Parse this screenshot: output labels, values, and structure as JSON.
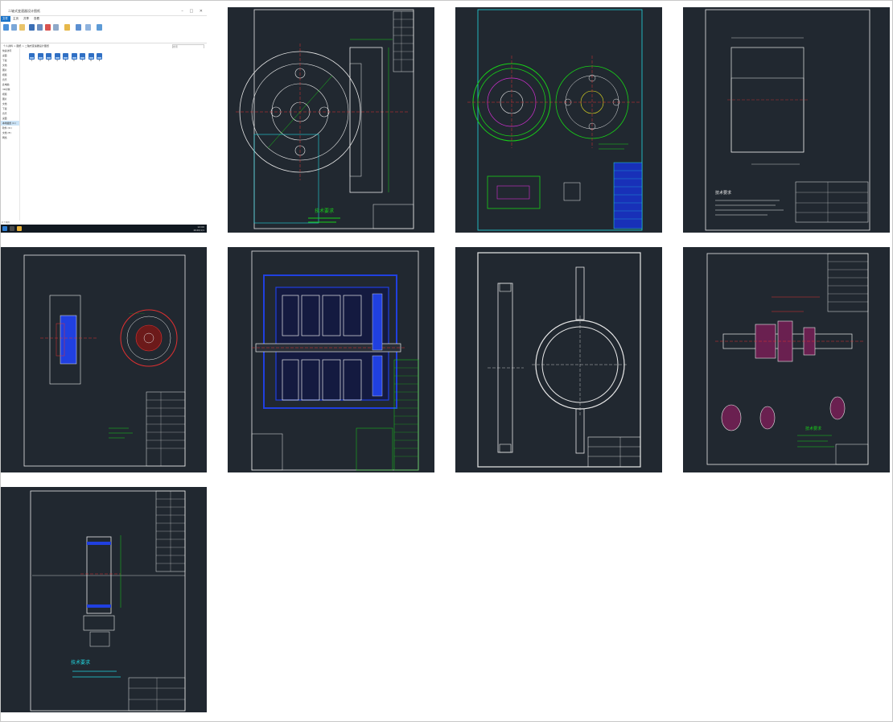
{
  "explorer": {
    "title": "二轴式变速器设计图纸",
    "tabs": [
      "文件",
      "主页",
      "共享",
      "查看"
    ],
    "address": "个人资料 > 图纸 > 二轴式变速器设计图纸",
    "search_placeholder": "搜索",
    "nav_items": [
      "快速访问",
      "桌面",
      "下载",
      "文档",
      "图片",
      "视频",
      "音乐",
      "此电脑",
      "3D对象",
      "视频",
      "图片",
      "文档",
      "下载",
      "音乐",
      "桌面",
      "本地磁盘 (C:)",
      "软件 (D:)",
      "文档 (E:)",
      "网络"
    ],
    "files": [
      "1",
      "2",
      "3",
      "4",
      "5",
      "6",
      "7",
      "8",
      "9"
    ],
    "status": "9 个项目",
    "clock_time": "12:00",
    "clock_date": "2020/1/1"
  },
  "drawings": [
    {
      "id": "flywheel",
      "notes": "技术要求"
    },
    {
      "id": "clutch-disc"
    },
    {
      "id": "shaft-sleeve",
      "notes": "技术要求"
    },
    {
      "id": "clutch-assembly"
    },
    {
      "id": "gearbox-assembly"
    },
    {
      "id": "ring-plate"
    },
    {
      "id": "gear-shaft",
      "notes": "技术要求"
    },
    {
      "id": "gear-blank",
      "notes": "技术要求"
    }
  ],
  "colors": {
    "cad_background": "#212830",
    "cad_white": "#e8e8e8",
    "cad_green": "#18d018",
    "cad_cyan": "#22d6e0",
    "cad_red": "#e03030",
    "cad_blue": "#2040e0",
    "cad_yellow": "#e8e020",
    "cad_magenta": "#d030d0",
    "explorer_accent": "#1a73c9"
  }
}
